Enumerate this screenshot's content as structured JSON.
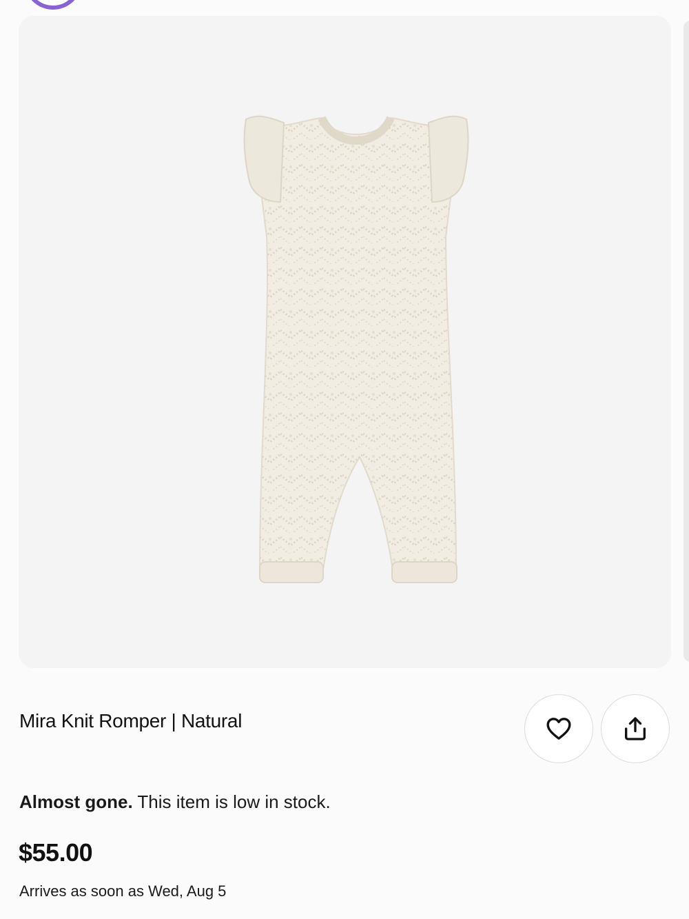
{
  "product": {
    "title": "Mira Knit Romper | Natural",
    "stock_label": "Almost gone.",
    "stock_text": " This item is low in stock.",
    "price": "$55.00",
    "arrival": "Arrives as soon as Wed, Aug 5",
    "image_name": "knit-romper-photo"
  },
  "actions": {
    "favorite_icon": "heart-icon",
    "share_icon": "share-icon"
  },
  "colors": {
    "card_background": "#f4f4f5",
    "garment": "#f1ede3",
    "avatar_ring": "#8a63d2"
  }
}
